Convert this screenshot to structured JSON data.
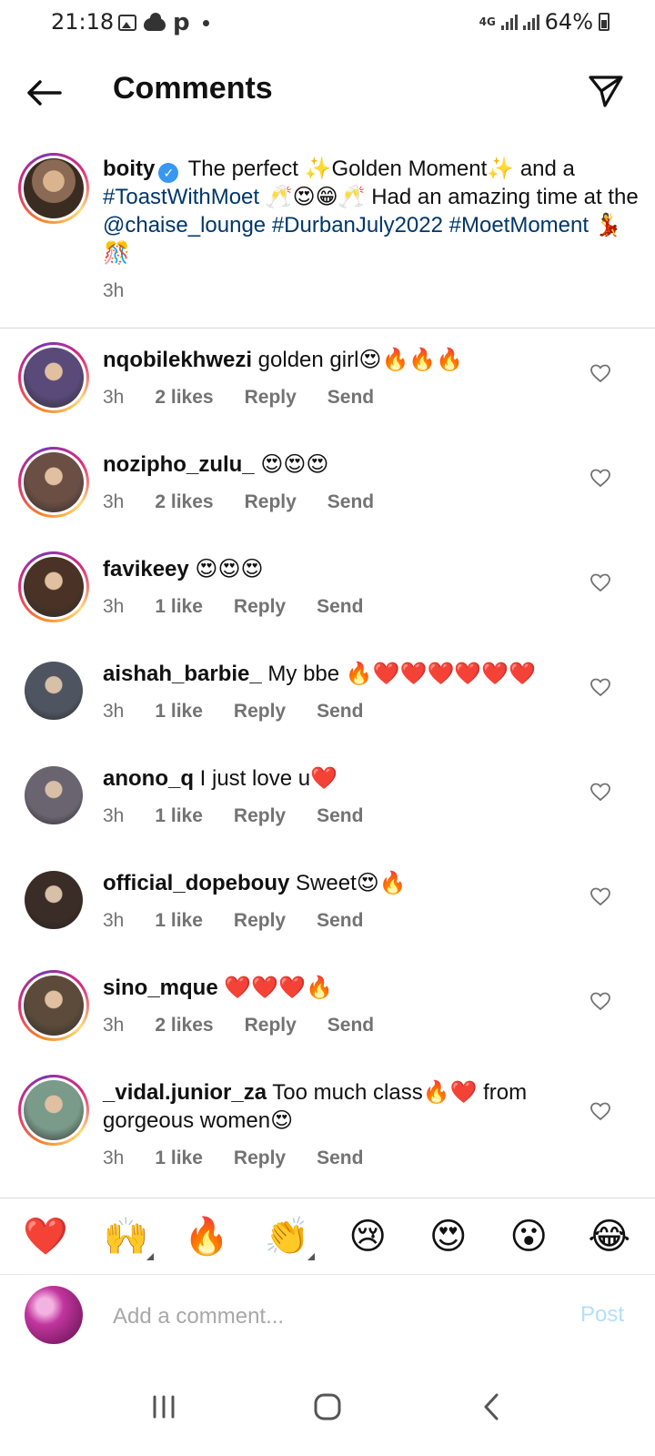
{
  "status_bar": {
    "time": "21:18",
    "network": "4G",
    "battery": "64%",
    "left_icons": [
      "image-icon",
      "cloud-icon",
      "p-icon",
      "dot-icon"
    ]
  },
  "header": {
    "title": "Comments",
    "back_icon": "arrow-left-icon",
    "send_icon": "paper-plane-icon"
  },
  "caption": {
    "username": "boity",
    "verified": true,
    "text_1": " The perfect ✨Golden Moment✨ and a ",
    "hashtag_1": "#ToastWithMoet",
    "text_2": " 🥂😍😁🥂 Had an amazing time at the ",
    "mention": "@chaise_lounge",
    "text_3": " ",
    "hashtag_2": "#DurbanJuly2022",
    "text_4": " ",
    "hashtag_3": "#MoetMoment",
    "text_5": " 💃🎊",
    "time": "3h",
    "avatar_color": "#8a6a55"
  },
  "comments": [
    {
      "username": "nqobilekhwezi",
      "text": " golden girl😍🔥🔥🔥",
      "time": "3h",
      "likes": "2 likes",
      "reply": "Reply",
      "send": "Send",
      "ring": true,
      "avatar_color": "#5a4a7a"
    },
    {
      "username": "nozipho_zulu_",
      "text": " 😍😍😍",
      "time": "3h",
      "likes": "2 likes",
      "reply": "Reply",
      "send": "Send",
      "ring": true,
      "avatar_color": "#6b4f44"
    },
    {
      "username": "favikeey",
      "text": " 😍😍😍",
      "time": "3h",
      "likes": "1 like",
      "reply": "Reply",
      "send": "Send",
      "ring": true,
      "avatar_color": "#4a3326"
    },
    {
      "username": "aishah_barbie_",
      "text": " My bbe 🔥❤️❤️❤️❤️❤️❤️",
      "time": "3h",
      "likes": "1 like",
      "reply": "Reply",
      "send": "Send",
      "ring": false,
      "avatar_color": "#4f5560"
    },
    {
      "username": "anono_q",
      "text": " I just love u❤️",
      "time": "3h",
      "likes": "1 like",
      "reply": "Reply",
      "send": "Send",
      "ring": false,
      "avatar_color": "#6a6470"
    },
    {
      "username": "official_dopebouy",
      "text": " Sweet😍🔥",
      "time": "3h",
      "likes": "1 like",
      "reply": "Reply",
      "send": "Send",
      "ring": false,
      "avatar_color": "#3a2c26"
    },
    {
      "username": "sino_mque",
      "text": " ❤️❤️❤️🔥",
      "time": "3h",
      "likes": "2 likes",
      "reply": "Reply",
      "send": "Send",
      "ring": true,
      "avatar_color": "#5c4b3a"
    },
    {
      "username": "_vidal.junior_za",
      "text": " Too much class🔥❤️ from gorgeous women😍",
      "time": "3h",
      "likes": "1 like",
      "reply": "Reply",
      "send": "Send",
      "ring": true,
      "avatar_color": "#7a9a8a"
    }
  ],
  "emoji_bar": [
    "❤️",
    "🙌",
    "🔥",
    "👏",
    "😢",
    "😍",
    "😮",
    "😂"
  ],
  "comment_input": {
    "placeholder": "Add a comment...",
    "post_label": "Post",
    "avatar_color": "#c2359e"
  },
  "nav_bar": [
    "recents-icon",
    "home-icon",
    "back-icon"
  ]
}
